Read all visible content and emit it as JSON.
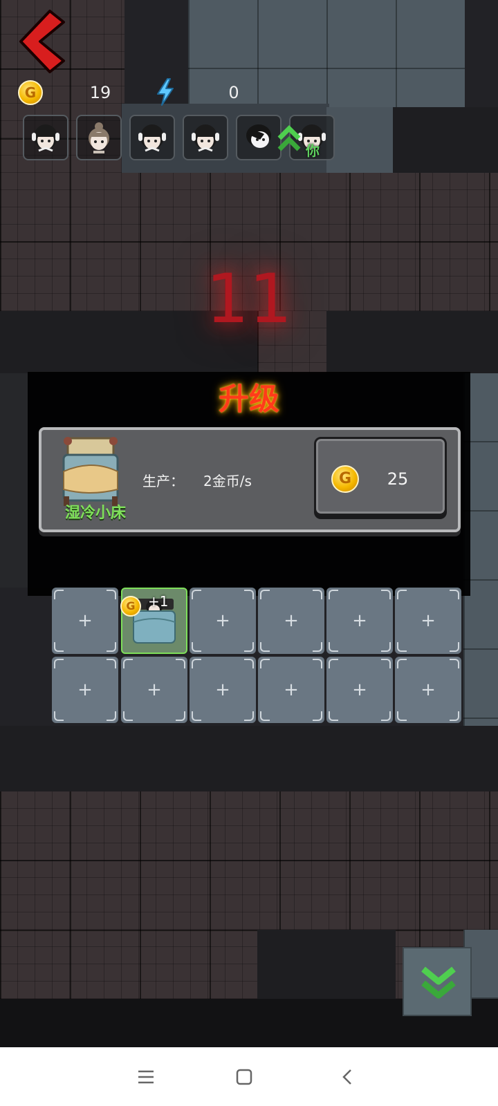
{
  "hud": {
    "coins": "19",
    "energy": "0",
    "coin_icon": "gold-coin-icon",
    "coin_glyph": "G",
    "energy_icon": "lightning-icon"
  },
  "players": [
    {
      "avatar": "girl-headphones-avatar"
    },
    {
      "avatar": "girl-bun-avatar"
    },
    {
      "avatar": "girl-headphones-avatar"
    },
    {
      "avatar": "girl-headphones-avatar"
    },
    {
      "avatar": "pale-ghost-avatar"
    },
    {
      "avatar": "girl-headphones-avatar",
      "label": "你"
    }
  ],
  "countdown": "11",
  "upgrade": {
    "title": "升级",
    "item_name": "湿冷小床",
    "produce_label": "生产：",
    "produce_value": "2金币/s",
    "cost": "25",
    "coin_glyph": "G"
  },
  "grid": {
    "empty_glyph": "+",
    "bed_income": "+1",
    "bed_coin_glyph": "G"
  },
  "colors": {
    "accent_red": "#d81e1e",
    "title_red": "#ff3b1a",
    "item_green": "#7fe05a",
    "coin_gold": "#f5b800"
  }
}
